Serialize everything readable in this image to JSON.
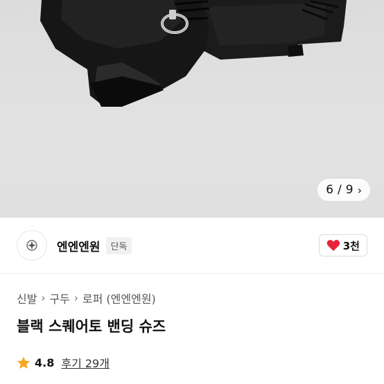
{
  "gallery": {
    "counter_current": "6",
    "counter_separator": "/",
    "counter_total": "9",
    "background_color": "#e0e0e0"
  },
  "seller": {
    "name": "엔엔엔원",
    "badge": "단독",
    "likes": "3천",
    "heart_color": "#e8243c"
  },
  "breadcrumb": [
    "신발",
    "구두",
    "로퍼 (엔엔엔원)"
  ],
  "product": {
    "title": "블랙 스퀘어토 밴딩 슈즈",
    "rating": "4.8",
    "reviews": "후기 29개",
    "star_color": "#f5a623"
  }
}
